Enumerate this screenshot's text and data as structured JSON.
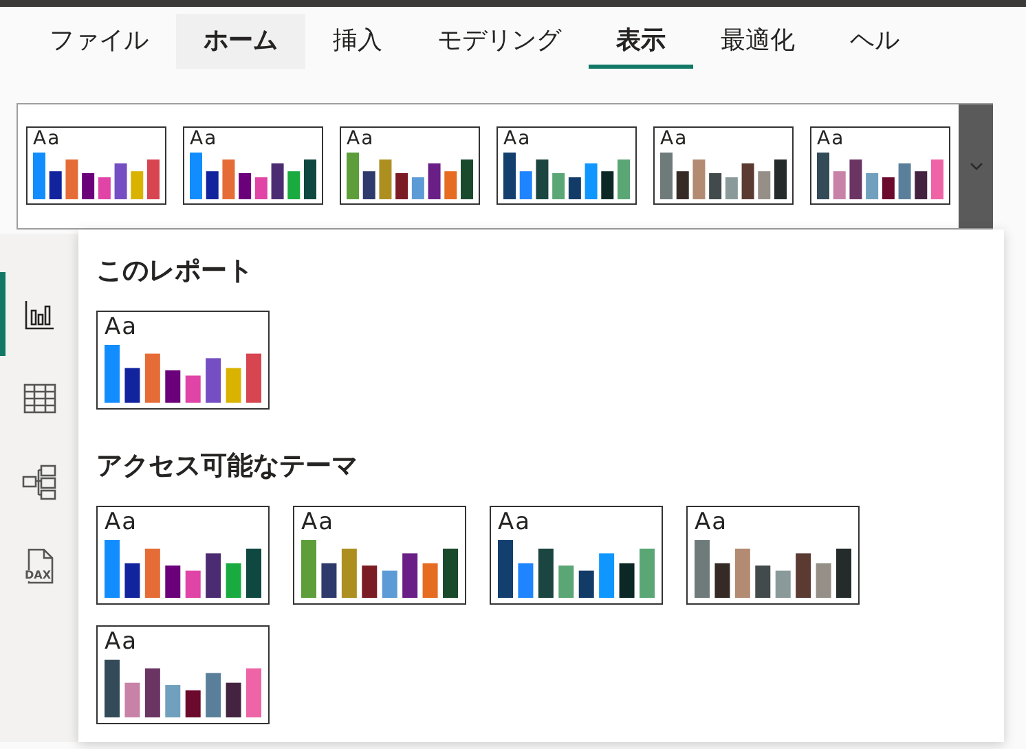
{
  "tabs": [
    {
      "label": "ファイル",
      "selected": false,
      "hovered": false
    },
    {
      "label": "ホーム",
      "selected": false,
      "hovered": true
    },
    {
      "label": "挿入",
      "selected": false,
      "hovered": false
    },
    {
      "label": "モデリング",
      "selected": false,
      "hovered": false
    },
    {
      "label": "表示",
      "selected": true,
      "hovered": false
    },
    {
      "label": "最適化",
      "selected": false,
      "hovered": false
    },
    {
      "label": "ヘル",
      "selected": false,
      "hovered": false
    }
  ],
  "ribbon_themes": [
    {
      "sample": "Aa",
      "bars": [
        {
          "color": "#118dff"
        },
        {
          "color": "#12239e"
        },
        {
          "color": "#e66c37"
        },
        {
          "color": "#6b007b"
        },
        {
          "color": "#e044a7"
        },
        {
          "color": "#744ec2"
        },
        {
          "color": "#d9b300"
        },
        {
          "color": "#d64550"
        }
      ]
    },
    {
      "sample": "Aa",
      "bars": [
        {
          "color": "#118dff"
        },
        {
          "color": "#12239e"
        },
        {
          "color": "#e66c37"
        },
        {
          "color": "#6b007b"
        },
        {
          "color": "#e044a7"
        },
        {
          "color": "#4b2c72"
        },
        {
          "color": "#1aab40"
        },
        {
          "color": "#0f4841"
        }
      ]
    },
    {
      "sample": "Aa",
      "bars": [
        {
          "color": "#5d9e3b"
        },
        {
          "color": "#2e3a6b"
        },
        {
          "color": "#ad8f20"
        },
        {
          "color": "#7b1c25"
        },
        {
          "color": "#5d9bd6"
        },
        {
          "color": "#6a1f87"
        },
        {
          "color": "#e66c21"
        },
        {
          "color": "#1a4a2c"
        }
      ]
    },
    {
      "sample": "Aa",
      "bars": [
        {
          "color": "#123f6e"
        },
        {
          "color": "#1f84ff"
        },
        {
          "color": "#1b4540"
        },
        {
          "color": "#5ba675"
        },
        {
          "color": "#133b68"
        },
        {
          "color": "#0f97ff"
        },
        {
          "color": "#0c2826"
        },
        {
          "color": "#5ba675"
        }
      ]
    },
    {
      "sample": "Aa",
      "bars": [
        {
          "color": "#6f7b7a"
        },
        {
          "color": "#362a27"
        },
        {
          "color": "#b38b72"
        },
        {
          "color": "#424a4b"
        },
        {
          "color": "#8a9a9b"
        },
        {
          "color": "#5b3a32"
        },
        {
          "color": "#958f87"
        },
        {
          "color": "#252a2a"
        }
      ]
    },
    {
      "sample": "Aa",
      "bars": [
        {
          "color": "#334a58"
        },
        {
          "color": "#c882a8"
        },
        {
          "color": "#6a3463"
        },
        {
          "color": "#70a0bd"
        },
        {
          "color": "#6b0a2d"
        },
        {
          "color": "#5a7f9a"
        },
        {
          "color": "#432340"
        },
        {
          "color": "#ee64a6"
        }
      ]
    }
  ],
  "sidebar": [
    {
      "kind": "report",
      "selected": true
    },
    {
      "kind": "table",
      "selected": false
    },
    {
      "kind": "model",
      "selected": false
    },
    {
      "kind": "dax",
      "selected": false,
      "label": "DAX"
    }
  ],
  "dropdown": {
    "sections": [
      {
        "heading": "このレポート",
        "themes": [
          {
            "sample": "Aa",
            "bars": [
              {
                "color": "#118dff"
              },
              {
                "color": "#12239e"
              },
              {
                "color": "#e66c37"
              },
              {
                "color": "#6b007b"
              },
              {
                "color": "#e044a7"
              },
              {
                "color": "#744ec2"
              },
              {
                "color": "#d9b300"
              },
              {
                "color": "#d64550"
              }
            ]
          }
        ]
      },
      {
        "heading": "アクセス可能なテーマ",
        "themes": [
          {
            "sample": "Aa",
            "bars": [
              {
                "color": "#118dff"
              },
              {
                "color": "#12239e"
              },
              {
                "color": "#e66c37"
              },
              {
                "color": "#6b007b"
              },
              {
                "color": "#e044a7"
              },
              {
                "color": "#4b2c72"
              },
              {
                "color": "#1aab40"
              },
              {
                "color": "#0f4841"
              }
            ]
          },
          {
            "sample": "Aa",
            "bars": [
              {
                "color": "#5d9e3b"
              },
              {
                "color": "#2e3a6b"
              },
              {
                "color": "#ad8f20"
              },
              {
                "color": "#7b1c25"
              },
              {
                "color": "#5d9bd6"
              },
              {
                "color": "#6a1f87"
              },
              {
                "color": "#e66c21"
              },
              {
                "color": "#1a4a2c"
              }
            ]
          },
          {
            "sample": "Aa",
            "bars": [
              {
                "color": "#123f6e"
              },
              {
                "color": "#1f84ff"
              },
              {
                "color": "#1b4540"
              },
              {
                "color": "#5ba675"
              },
              {
                "color": "#133b68"
              },
              {
                "color": "#0f97ff"
              },
              {
                "color": "#0c2826"
              },
              {
                "color": "#5ba675"
              }
            ]
          },
          {
            "sample": "Aa",
            "bars": [
              {
                "color": "#6f7b7a"
              },
              {
                "color": "#362a27"
              },
              {
                "color": "#b38b72"
              },
              {
                "color": "#424a4b"
              },
              {
                "color": "#8a9a9b"
              },
              {
                "color": "#5b3a32"
              },
              {
                "color": "#958f87"
              },
              {
                "color": "#252a2a"
              }
            ]
          },
          {
            "sample": "Aa",
            "bars": [
              {
                "color": "#334a58"
              },
              {
                "color": "#c882a8"
              },
              {
                "color": "#6a3463"
              },
              {
                "color": "#70a0bd"
              },
              {
                "color": "#6b0a2d"
              },
              {
                "color": "#5a7f9a"
              },
              {
                "color": "#432340"
              },
              {
                "color": "#ee64a6"
              }
            ]
          }
        ]
      }
    ]
  }
}
